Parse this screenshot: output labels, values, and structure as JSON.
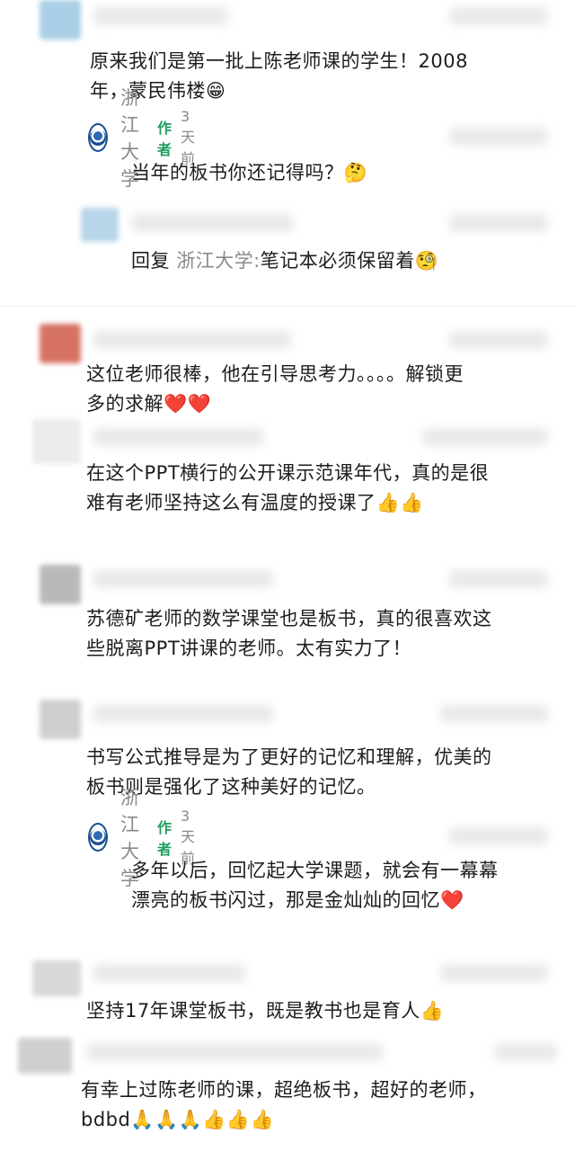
{
  "comments": [
    {
      "text_lines": [
        "原来我们是第一批上陈老师课的学生！2008",
        "年，蒙民伟楼😁"
      ],
      "avatar_color": "#a9cfe6",
      "reply": {
        "author": "浙江大学",
        "tag": "作者",
        "time": "3天前",
        "text_lines": [
          "当年的板书你还记得吗？🤔"
        ]
      },
      "sub_reply": {
        "prefix": "回复",
        "target": "浙江大学:",
        "text": "笔记本必须保留着🧐"
      },
      "sub_reply_avatar_color": "#b8d5ea"
    },
    {
      "text_lines": [
        "这位老师很棒，他在引导思考力。。。。解锁更",
        "多的求解❤️❤️"
      ],
      "avatar_color": "#d67264"
    },
    {
      "text_lines": [
        "在这个PPT横行的公开课示范课年代，真的是很",
        "难有老师坚持这么有温度的授课了👍👍"
      ],
      "avatar_color": "#ececec"
    },
    {
      "text_lines": [
        "苏德矿老师的数学课堂也是板书，真的很喜欢这",
        "些脱离PPT讲课的老师。太有实力了！"
      ],
      "avatar_color": "#b9b9b9"
    },
    {
      "text_lines": [
        "书写公式推导是为了更好的记忆和理解，优美的",
        "板书则是强化了这种美好的记忆。"
      ],
      "avatar_color": "#cfcfcf",
      "reply": {
        "author": "浙江大学",
        "tag": "作者",
        "time": "3天前",
        "text_lines": [
          "多年以后，回忆起大学课题，就会有一幕幕",
          "漂亮的板书闪过，那是金灿灿的回忆❤️"
        ]
      }
    },
    {
      "text_lines": [
        "坚持17年课堂板书，既是教书也是育人👍"
      ],
      "avatar_color": "#d8d8d8"
    },
    {
      "text_lines": [
        "有幸上过陈老师的课，超绝板书，超好的老师，",
        "bdbd🙏🙏🙏👍👍👍"
      ],
      "avatar_color": "#cfcfcf"
    }
  ]
}
